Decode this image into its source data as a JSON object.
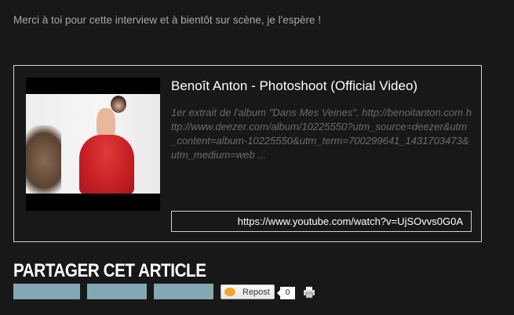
{
  "intro_text": "Merci à toi pour cette interview et à bientôt sur scène, je l'espère !",
  "embed": {
    "title": "Benoît Anton - Photoshoot (Official Video)",
    "description": "1er extrait de l'album \"Dans Mes Veines\". http://benoitanton.com http://www.deezer.com/album/10225550?utm_source=deezer&utm_content=album-10225550&utm_term=700299641_1431703473&utm_medium=web ...",
    "url": "https://www.youtube.com/watch?v=UjSOvvs0G0A",
    "thumbnail_icon": "video-thumbnail"
  },
  "share": {
    "heading": "PARTAGER CET ARTICLE",
    "repost_label": "Repost",
    "repost_count": "0",
    "button_color": "#84a8b3"
  },
  "colors": {
    "background": "#181818",
    "intro_text": "#a9a9a9",
    "description_text": "#6b6b6b",
    "border": "#cfcfcf"
  }
}
